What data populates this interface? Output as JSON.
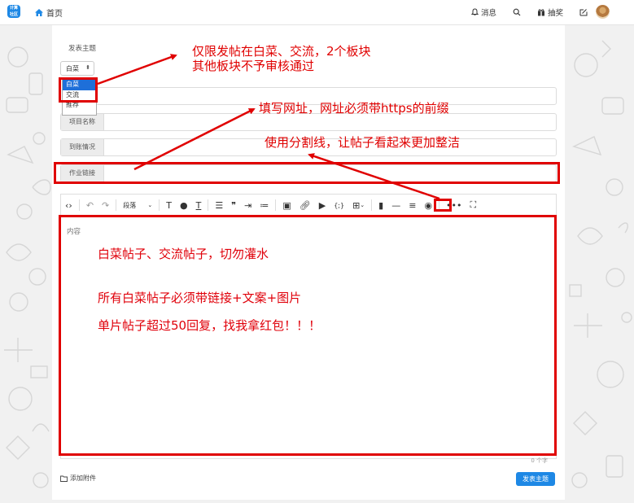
{
  "header": {
    "logo_text": "计算\n社区",
    "home_label": "首页",
    "messages_label": "消息",
    "lottery_label": "抽奖"
  },
  "form": {
    "title_label": "发表主题",
    "category_selected": "白菜",
    "category_options": [
      "白菜",
      "交流",
      "推荐"
    ],
    "fields": [
      {
        "label": "项目名称"
      },
      {
        "label": "到账情况"
      },
      {
        "label": "作业链接"
      }
    ],
    "toolbar": {
      "paragraph_label": "段落"
    },
    "editor": {
      "placeholder": "内容",
      "lines": [
        "白菜帖子、交流帖子，切勿灌水",
        "所有白菜帖子必须带链接+文案+图片",
        "单片帖子超过50回复，找我拿红包！！！"
      ],
      "counter": "0 个字"
    },
    "attach_label": "添加附件",
    "submit_label": "发表主题"
  },
  "annotations": {
    "a1_line1": "仅限发帖在白菜、交流，2个板块",
    "a1_line2": "其他板块不予审核通过",
    "a2": "填写网址，网址必须带https的前缀",
    "a3": "使用分割线，让帖子看起来更加整洁"
  },
  "colors": {
    "annotation_red": "#e00000",
    "accent_blue": "#1e88e5"
  }
}
